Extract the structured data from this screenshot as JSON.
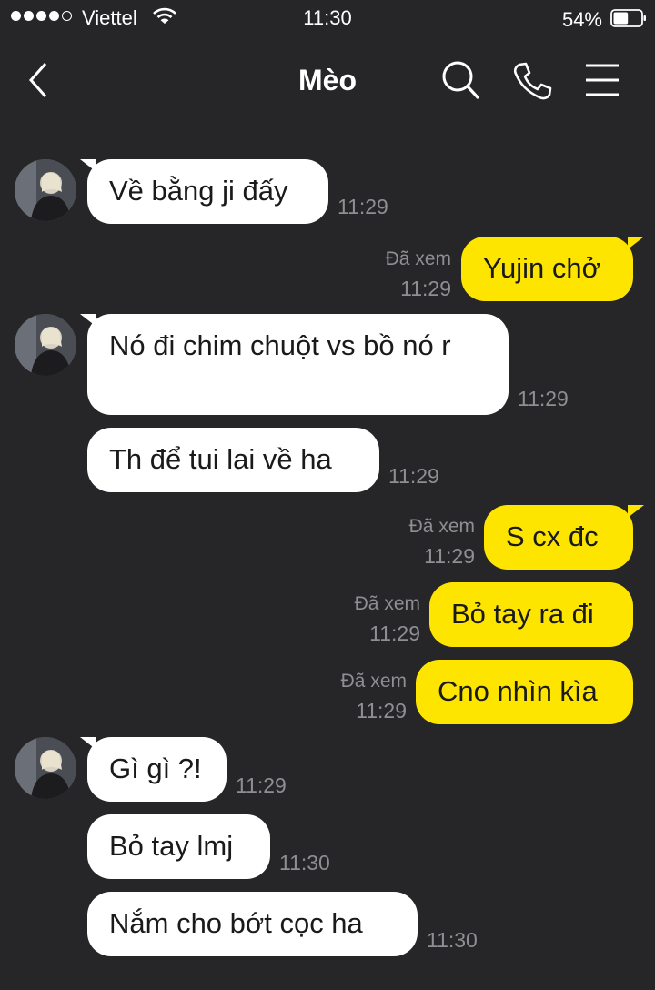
{
  "status_bar": {
    "carrier": "Viettel",
    "time": "11:30",
    "battery": "54%",
    "battery_level": 0.54
  },
  "header": {
    "title": "Mèo",
    "icons": [
      "back-icon",
      "search-icon",
      "phone-icon",
      "menu-icon"
    ]
  },
  "messages": [
    {
      "side": "in",
      "text": "Về bằng ji đấy",
      "time": "11:29"
    },
    {
      "side": "out",
      "text": "Yujin chở",
      "status": "Đã xem",
      "time": "11:29"
    },
    {
      "side": "in",
      "text": "Nó đi chim chuột vs bồ nó r",
      "time": "11:29"
    },
    {
      "side": "in",
      "text": "Th để tui lai về ha",
      "time": "11:29"
    },
    {
      "side": "out",
      "text": "S cx đc",
      "status": "Đã xem",
      "time": "11:29"
    },
    {
      "side": "out",
      "text": "Bỏ tay ra đi",
      "status": "Đã xem",
      "time": "11:29"
    },
    {
      "side": "out",
      "text": "Cno nhìn kìa",
      "status": "Đã xem",
      "time": "11:29"
    },
    {
      "side": "in",
      "text": "Gì gì ?!",
      "time": "11:29"
    },
    {
      "side": "in",
      "text": "Bỏ tay lmj",
      "time": "11:30"
    },
    {
      "side": "in",
      "text": "Nắm cho bớt cọc ha",
      "time": "11:30"
    }
  ],
  "colors": {
    "background": "#262628",
    "incoming_bubble": "#ffffff",
    "outgoing_bubble": "#fee500",
    "meta_text": "#8e8e93"
  }
}
